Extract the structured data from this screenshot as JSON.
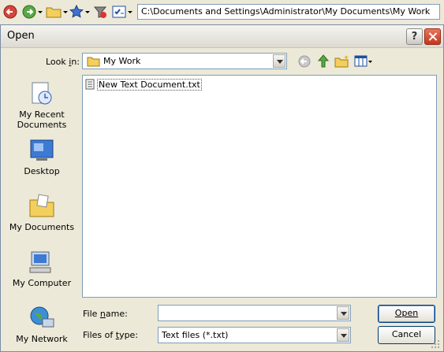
{
  "toolbar": {
    "address": "C:\\Documents and Settings\\Administrator\\My Documents\\My Work",
    "icons": [
      "back-icon",
      "forward-icon",
      "folder-icon",
      "favorites-star-icon",
      "filter-icon",
      "checklist-icon"
    ]
  },
  "dialog": {
    "title": "Open",
    "help_label": "?",
    "look_in_label": "Look in:",
    "look_in_value": "My Work",
    "places": [
      {
        "label": "My Recent Documents",
        "icon": "recent-documents-icon"
      },
      {
        "label": "Desktop",
        "icon": "desktop-icon"
      },
      {
        "label": "My Documents",
        "icon": "my-documents-icon"
      },
      {
        "label": "My Computer",
        "icon": "my-computer-icon"
      },
      {
        "label": "My Network",
        "icon": "my-network-icon"
      }
    ],
    "files": [
      {
        "name": "New Text Document.txt",
        "icon": "text-file-icon"
      }
    ],
    "file_name_label": "File name:",
    "file_name_value": "",
    "files_of_type_label": "Files of type:",
    "files_of_type_value": "Text files (*.txt)",
    "open_label": "Open",
    "cancel_label": "Cancel"
  },
  "colors": {
    "dialog_bg": "#ece9d8",
    "field_border": "#7f9db9",
    "close_red": "#c2361d"
  }
}
